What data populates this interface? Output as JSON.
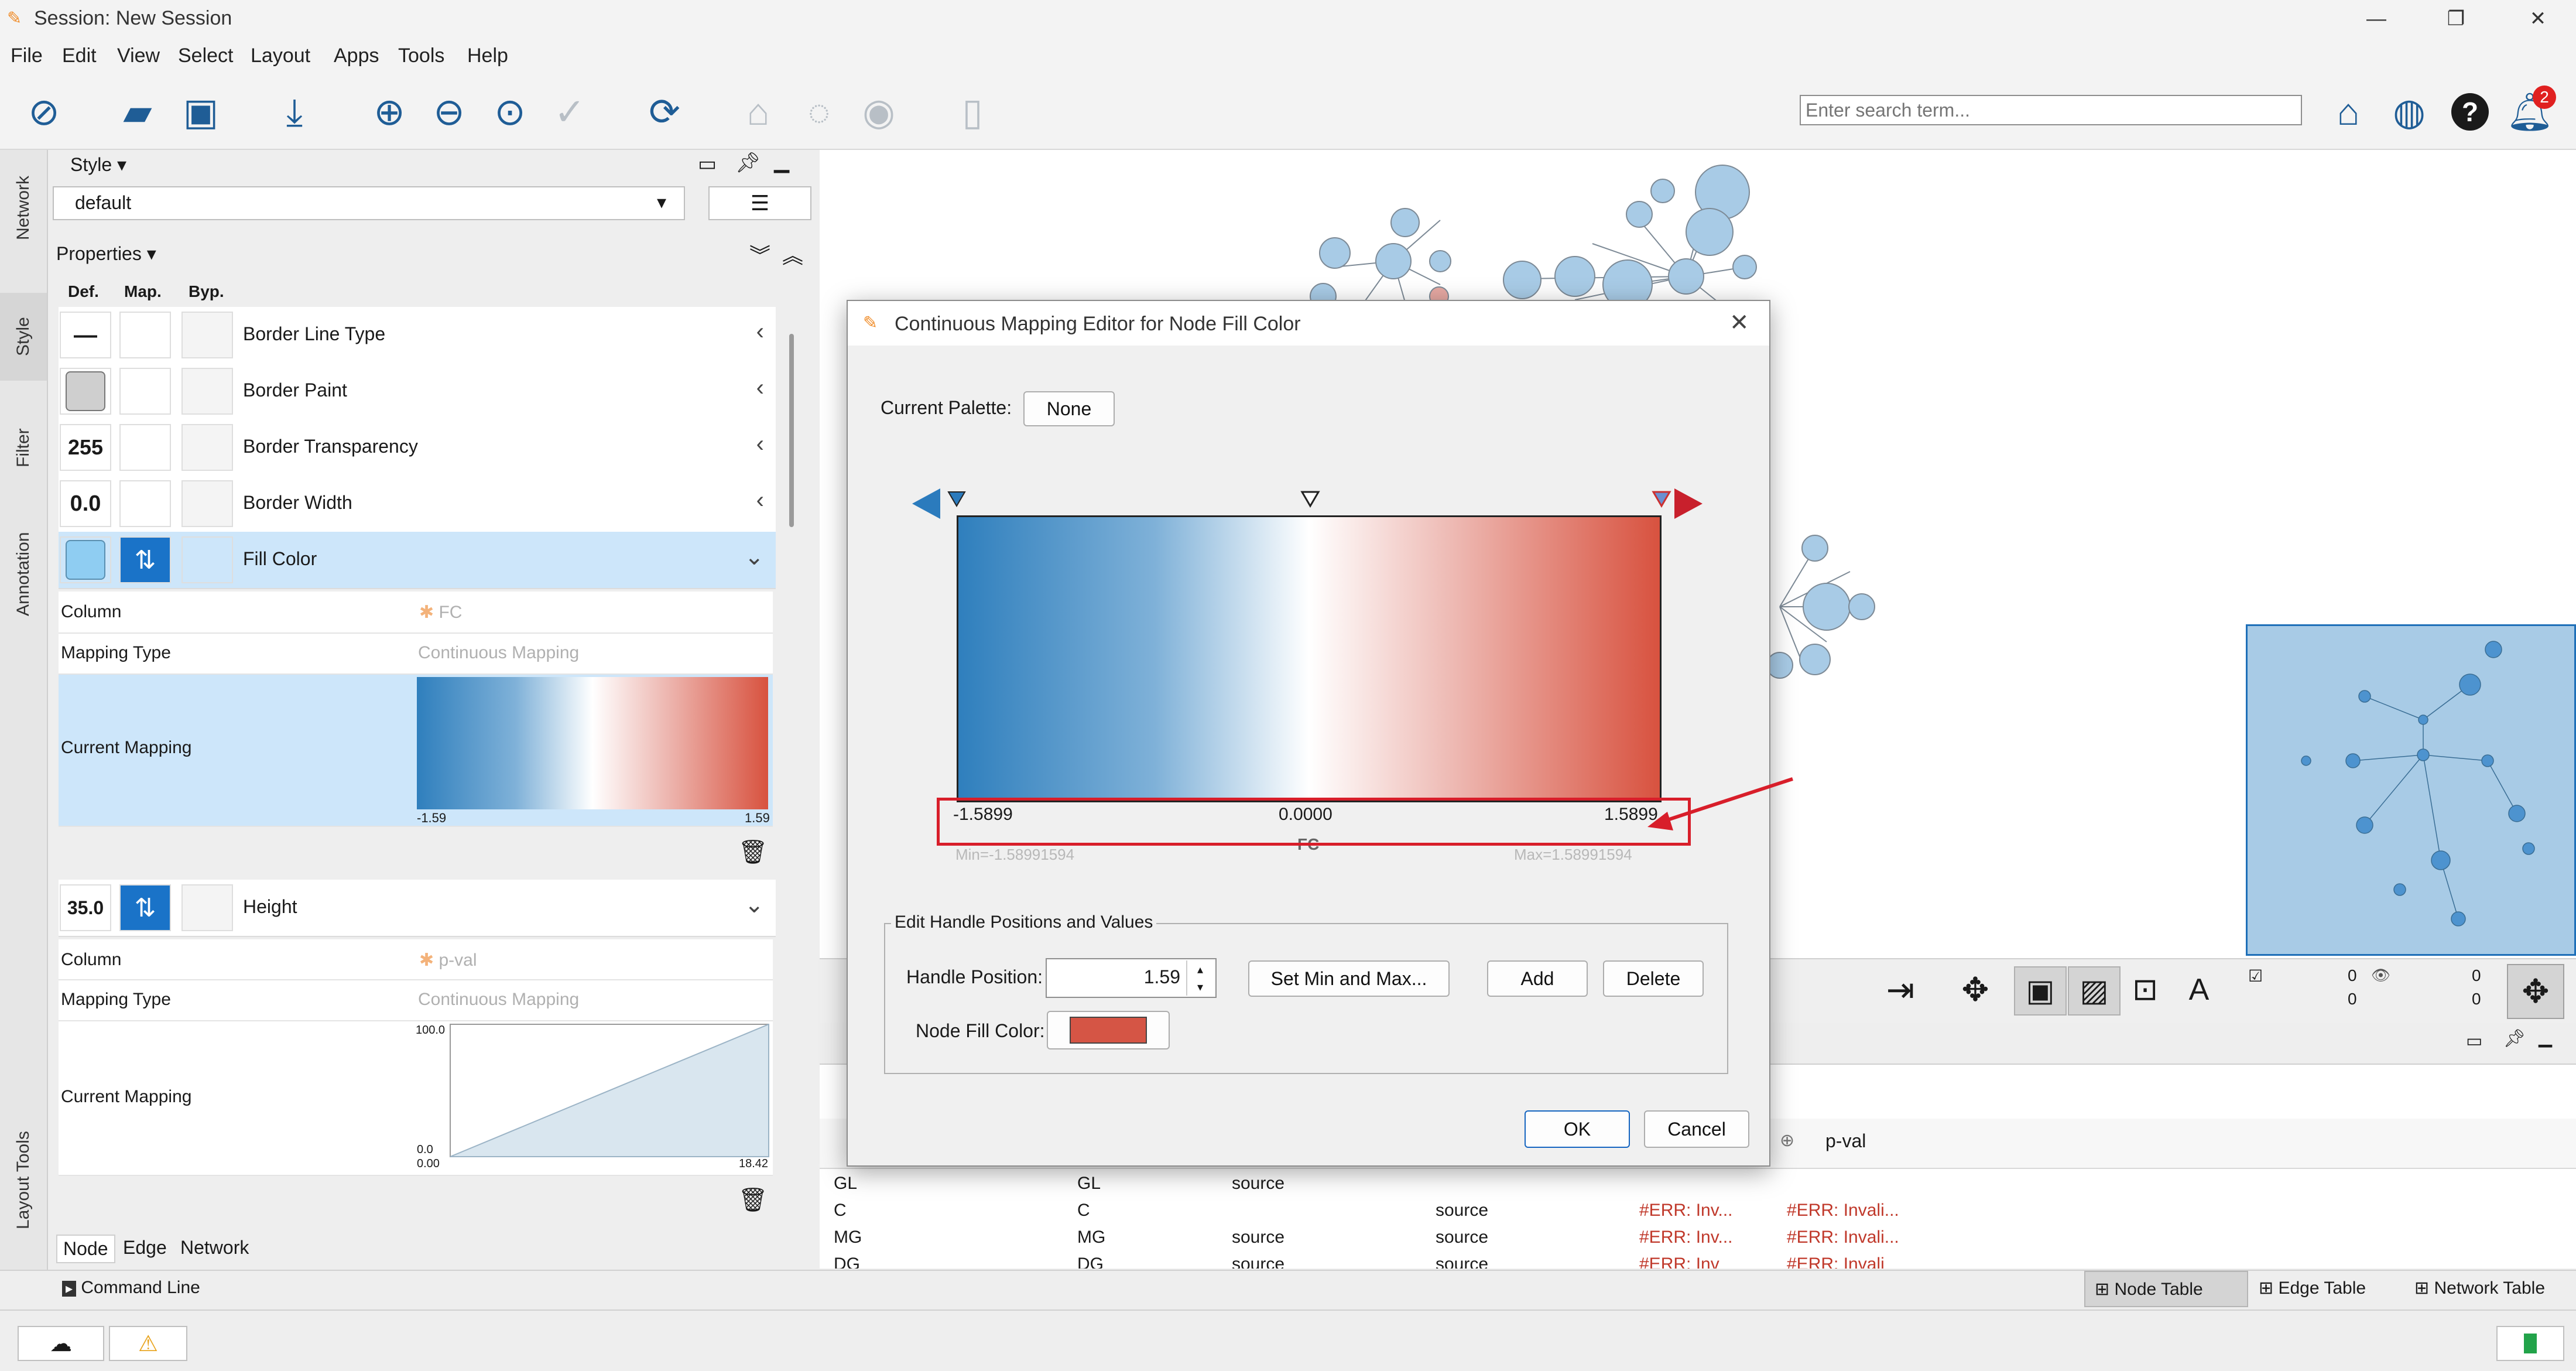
{
  "window": {
    "title": "Session: New Session",
    "controls": {
      "minimize": "—",
      "maximize": "❐",
      "close": "✕"
    }
  },
  "menu": [
    "File",
    "Edit",
    "View",
    "Select",
    "Layout",
    "Apps",
    "Tools",
    "Help"
  ],
  "toolbar": {
    "search_placeholder": "Enter search term...",
    "notification_count": "2"
  },
  "left_tabs": [
    "Network",
    "Style",
    "Filter",
    "Annotation",
    "Layout Tools"
  ],
  "style_panel": {
    "header": "Style",
    "style_value": "default",
    "properties_label": "Properties",
    "columns": [
      "Def.",
      "Map.",
      "Byp."
    ],
    "rows": [
      {
        "def": "—",
        "label": "Border Line Type",
        "arrow": "‹"
      },
      {
        "def": "",
        "label": "Border Paint",
        "arrow": "‹"
      },
      {
        "def": "255",
        "label": "Border Transparency",
        "arrow": "‹"
      },
      {
        "def": "0.0",
        "label": "Border Width",
        "arrow": "‹"
      },
      {
        "def": "",
        "label": "Fill Color",
        "arrow": "⌄"
      }
    ],
    "fill_color_detail": {
      "column_label": "Column",
      "column_value": "FC",
      "mapping_type_label": "Mapping Type",
      "mapping_type_value": "Continuous Mapping",
      "current_mapping_label": "Current Mapping",
      "min": "-1.59",
      "max": "1.59"
    },
    "height_row": {
      "def": "35.0",
      "label": "Height",
      "arrow": "⌄"
    },
    "height_detail": {
      "column_label": "Column",
      "column_value": "p-val",
      "mapping_type_label": "Mapping Type",
      "mapping_type_value": "Continuous Mapping",
      "current_mapping_label": "Current Mapping",
      "y_max": "100.0",
      "y_min": "0.0",
      "x_min": "0.00",
      "x_max": "18.42"
    },
    "bottom_tabs": [
      "Node",
      "Edge",
      "Network"
    ]
  },
  "dialog": {
    "title": "Continuous Mapping Editor for Node Fill Color",
    "current_palette_label": "Current Palette:",
    "current_palette_value": "None",
    "axis": {
      "left_value": "-1.5899",
      "mid_value": "0.0000",
      "right_value": "1.5899",
      "column": "FC",
      "min_label": "Min=-1.58991594",
      "max_label": "Max=1.58991594"
    },
    "edit_group_label": "Edit Handle Positions and Values",
    "handle_position_label": "Handle Position:",
    "handle_position_value": "1.59",
    "set_min_max_button": "Set Min and Max...",
    "add_button": "Add",
    "delete_button": "Delete",
    "node_fill_color_label": "Node Fill Color:",
    "node_fill_color": "#d55545",
    "ok_button": "OK",
    "cancel_button": "Cancel"
  },
  "network_toolbar": {
    "count_a": "0",
    "count_b": "0",
    "count_c": "0",
    "count_d": "0"
  },
  "table": {
    "header_partial": "p-val",
    "rows": [
      {
        "a": "GL",
        "b": "GL",
        "c": "source",
        "d": "",
        "e": "",
        "f": ""
      },
      {
        "a": "C",
        "b": "C",
        "c": "",
        "d": "source",
        "e": "#ERR: Inv...",
        "f": "#ERR: Invali..."
      },
      {
        "a": "MG",
        "b": "MG",
        "c": "source",
        "d": "source",
        "e": "#ERR: Inv...",
        "f": "#ERR: Invali..."
      },
      {
        "a": "DG",
        "b": "DG",
        "c": "source",
        "d": "source",
        "e": "#ERR: Inv",
        "f": "#ERR: Invali"
      }
    ]
  },
  "status": {
    "command_line": "Command Line",
    "tabs": [
      "Node Table",
      "Edge Table",
      "Network Table"
    ]
  },
  "colors": {
    "accent": "#1f5d96",
    "selection": "#cde6fa",
    "fill_default": "#8fcdf2",
    "annotation_red": "#d81e2a"
  }
}
